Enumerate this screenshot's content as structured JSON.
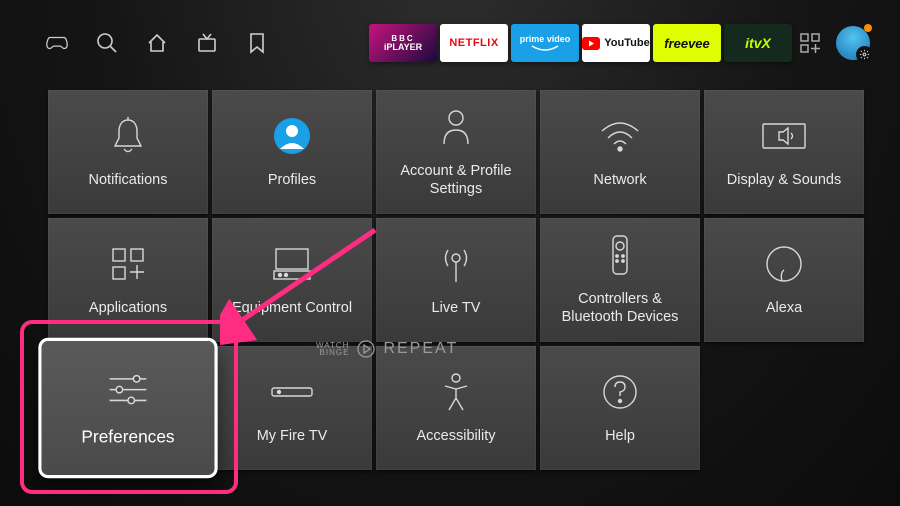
{
  "topbar": {
    "nav": [
      "controller",
      "search",
      "home",
      "tv",
      "bookmark"
    ],
    "apps": {
      "bbc_line1": "BBC",
      "bbc_line2": "iPLAYER",
      "netflix": "NETFLIX",
      "prime_line1": "prime video",
      "youtube": "YouTube",
      "freevee": "freevee",
      "itvx": "itvX"
    }
  },
  "tiles": [
    {
      "id": "notifications",
      "label": "Notifications"
    },
    {
      "id": "profiles",
      "label": "Profiles"
    },
    {
      "id": "account",
      "label": "Account & Profile Settings"
    },
    {
      "id": "network",
      "label": "Network"
    },
    {
      "id": "display",
      "label": "Display & Sounds"
    },
    {
      "id": "applications",
      "label": "Applications"
    },
    {
      "id": "equipment",
      "label": "Equipment Control"
    },
    {
      "id": "livetv",
      "label": "Live TV"
    },
    {
      "id": "controllers",
      "label": "Controllers & Bluetooth Devices"
    },
    {
      "id": "alexa",
      "label": "Alexa"
    },
    {
      "id": "preferences",
      "label": "Preferences",
      "selected": true
    },
    {
      "id": "firetv",
      "label": "My Fire TV"
    },
    {
      "id": "accessibility",
      "label": "Accessibility"
    },
    {
      "id": "help",
      "label": "Help"
    }
  ],
  "watermark": {
    "small1": "WATCH",
    "small2": "BINGE",
    "big": "REPEAT"
  },
  "annotation": {
    "highlight_tile": "preferences"
  }
}
